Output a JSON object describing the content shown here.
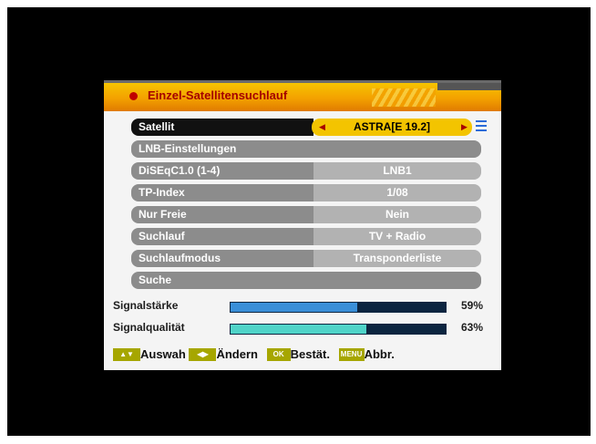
{
  "title": "Einzel-Satellitensuchlauf",
  "menu": [
    {
      "label": "Satellit",
      "value": "ASTRA[E 19.2]"
    },
    {
      "label": "LNB-Einstellungen",
      "value": ""
    },
    {
      "label": "DiSEqC1.0 (1-4)",
      "value": "LNB1"
    },
    {
      "label": "TP-Index",
      "value": "1/08"
    },
    {
      "label": "Nur Freie",
      "value": "Nein"
    },
    {
      "label": "Suchlauf",
      "value": "TV + Radio"
    },
    {
      "label": "Suchlaufmodus",
      "value": "Transponderliste"
    },
    {
      "label": "Suche",
      "value": ""
    }
  ],
  "signal": {
    "strength_label": "Signalstärke",
    "strength_value": "59%",
    "strength_fraction": 0.59,
    "quality_label": "Signalqualität",
    "quality_value": "63%",
    "quality_fraction": 0.63,
    "strength_color": "#3a8fd8",
    "quality_color": "#4fd3c8"
  },
  "footer": {
    "select": "Auswah",
    "change": "Ändern",
    "ok_key": "OK",
    "confirm": "Bestät.",
    "menu_key": "MENU",
    "cancel": "Abbr."
  }
}
